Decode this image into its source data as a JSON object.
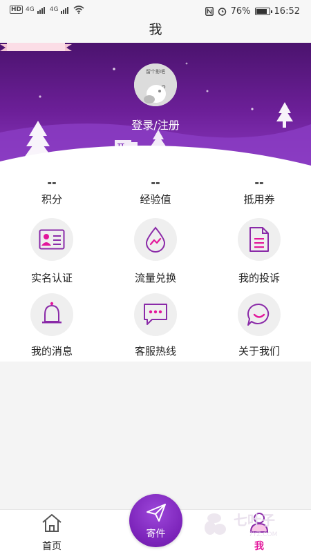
{
  "status_bar": {
    "left_badges": [
      "HD",
      "4G",
      "4G"
    ],
    "battery": "76%",
    "battery_level": 0.76,
    "time": "16:52"
  },
  "header": {
    "title": "我"
  },
  "profile": {
    "avatar_caption": "留个影吧",
    "login_label": "登录/注册",
    "truck_text": "TT"
  },
  "stats": [
    {
      "value": "--",
      "label": "积分"
    },
    {
      "value": "--",
      "label": "经验值"
    },
    {
      "value": "--",
      "label": "抵用券"
    }
  ],
  "menu": [
    {
      "label": "实名认证",
      "icon": "id-card-icon"
    },
    {
      "label": "流量兑换",
      "icon": "data-drop-icon"
    },
    {
      "label": "我的投诉",
      "icon": "document-icon"
    },
    {
      "label": "我的消息",
      "icon": "bell-icon"
    },
    {
      "label": "客服热线",
      "icon": "chat-bubble-icon"
    },
    {
      "label": "关于我们",
      "icon": "smile-bubble-icon"
    }
  ],
  "bottom_nav": {
    "home_label": "首页",
    "send_label": "寄件",
    "me_label": "我"
  },
  "watermark": {
    "text": "七叶子",
    "sub": "7YZ.COM"
  },
  "colors": {
    "accent": "#e3169b",
    "purple": "#7a22b8",
    "hero_top": "#4b136e"
  }
}
